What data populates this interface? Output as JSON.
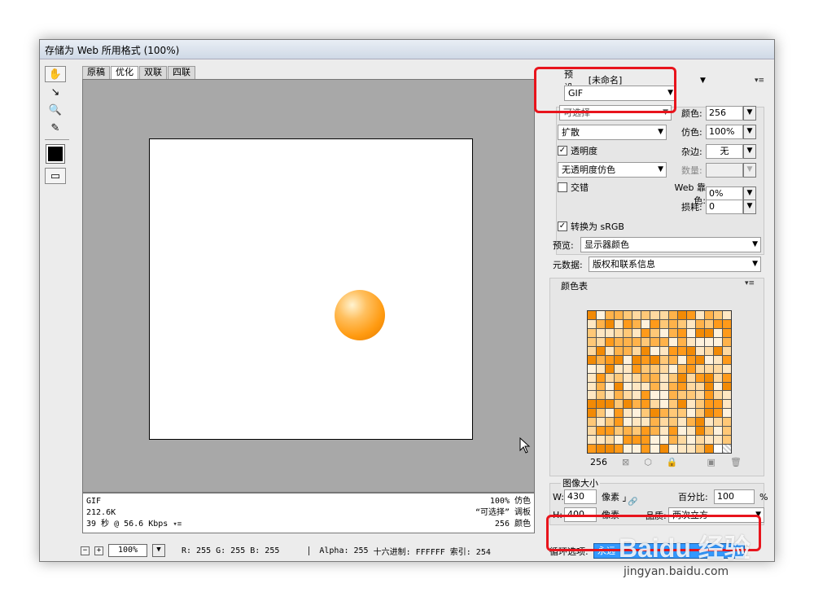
{
  "window": {
    "title": "存储为 Web 所用格式 (100%)"
  },
  "tools": [
    "hand-tool-icon",
    "slice-select-tool-icon",
    "zoom-tool-icon",
    "eyedropper-tool-icon"
  ],
  "tabs": [
    "原稿",
    "优化",
    "双联",
    "四联"
  ],
  "info": {
    "format": "GIF",
    "size": "212.6K",
    "time": "39 秒 @ 56.6 Kbps",
    "dither_line": "100% 仿色",
    "palette_line": "“可选择” 调板",
    "colors_line": "256 颜色"
  },
  "status": {
    "zoom": "100%",
    "r": "R: 255",
    "g": "G: 255",
    "b": "B: 255",
    "alpha": "Alpha: 255",
    "hex": "十六进制: FFFFFF",
    "index": "索引: 254"
  },
  "settings": {
    "preset_label": "预设:",
    "preset_value": "[未命名]",
    "format": "GIF",
    "reduction_value": "可选择",
    "colors_label": "颜色:",
    "colors_value": "256",
    "dither_algo": "扩散",
    "dither_label": "仿色:",
    "dither_value": "100%",
    "transparency_label": "透明度",
    "matte_label": "杂边:",
    "matte_value": "无",
    "trans_dither": "无透明度仿色",
    "amount_label": "数量:",
    "interlace_label": "交错",
    "websnap_label": "Web 靠色:",
    "websnap_value": "0%",
    "lossy_label": "损耗:",
    "lossy_value": "0",
    "convert_label": "转换为 sRGB",
    "preview_label": "预览:",
    "preview_value": "显示器颜色",
    "metadata_label": "元数据:",
    "metadata_value": "版权和联系信息"
  },
  "palette": {
    "title": "颜色表",
    "count": "256"
  },
  "image_size": {
    "title": "图像大小",
    "w_label": "W:",
    "w_value": "430",
    "px1": "像素",
    "h_label": "H:",
    "h_value": "400",
    "px2": "像素",
    "percent_label": "百分比:",
    "percent_value": "100",
    "percent_unit": "%",
    "quality_label": "品质:",
    "quality_value": "两次立方"
  },
  "animation": {
    "loop_label": "循环选项:",
    "loop_value": "永远"
  },
  "watermark": {
    "brand": "Baidu 经验",
    "url": "jingyan.baidu.com"
  },
  "colors": {
    "highlight": "#e8141c",
    "selection": "#3399ff",
    "orange": "#ff9a10"
  }
}
